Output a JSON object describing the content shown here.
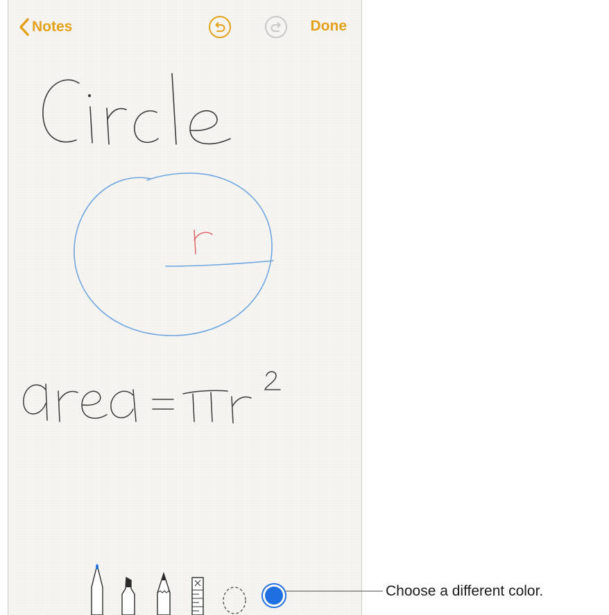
{
  "navbar": {
    "back_label": "Notes",
    "done_label": "Done",
    "undo_icon": "undo-icon",
    "redo_icon": "redo-icon",
    "accent_color": "#e4a11b"
  },
  "note": {
    "title_text": "Circle",
    "radius_label": "r",
    "formula_text": "area = πr",
    "formula_superscript": "2",
    "ink_color": "#3a3a3a",
    "circle_color": "#6fa6e0",
    "radius_label_color": "#e05a5a"
  },
  "toolbar": {
    "tools": [
      "pen-tool",
      "marker-tool",
      "pencil-tool",
      "ruler-tool",
      "lasso-tool",
      "color-picker"
    ],
    "selected_color": "#1e6fe0"
  },
  "callout": {
    "text": "Choose a different color."
  }
}
